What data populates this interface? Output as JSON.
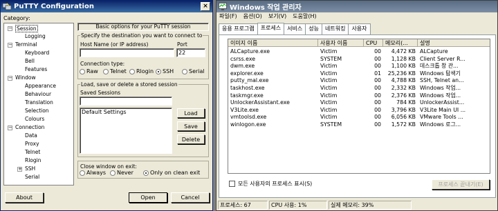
{
  "putty": {
    "title": "PuTTY Configuration",
    "close_btn": "×",
    "category_label": "Category:",
    "tree": [
      {
        "label": "Session",
        "level": 0,
        "toggle": "−",
        "selected": true
      },
      {
        "label": "Logging",
        "level": 1
      },
      {
        "label": "Terminal",
        "level": 0,
        "toggle": "−"
      },
      {
        "label": "Keyboard",
        "level": 1
      },
      {
        "label": "Bell",
        "level": 1
      },
      {
        "label": "Features",
        "level": 1
      },
      {
        "label": "Window",
        "level": 0,
        "toggle": "−"
      },
      {
        "label": "Appearance",
        "level": 1
      },
      {
        "label": "Behaviour",
        "level": 1
      },
      {
        "label": "Translation",
        "level": 1
      },
      {
        "label": "Selection",
        "level": 1
      },
      {
        "label": "Colours",
        "level": 1
      },
      {
        "label": "Connection",
        "level": 0,
        "toggle": "−"
      },
      {
        "label": "Data",
        "level": 1
      },
      {
        "label": "Proxy",
        "level": 1
      },
      {
        "label": "Telnet",
        "level": 1
      },
      {
        "label": "Rlogin",
        "level": 1
      },
      {
        "label": "SSH",
        "level": 1,
        "toggle": "+"
      },
      {
        "label": "Serial",
        "level": 1
      }
    ],
    "header": "Basic options for your PuTTY session",
    "dest_label": "Specify the destination you want to connect to",
    "host_label": "Host Name (or IP address)",
    "host_value": "",
    "port_label": "Port",
    "port_value": "22",
    "conn_type_label": "Connection type:",
    "conn_types": [
      "Raw",
      "Telnet",
      "Rlogin",
      "SSH",
      "Serial"
    ],
    "conn_selected": "SSH",
    "sessions_group": "Load, save or delete a stored session",
    "saved_sessions_label": "Saved Sessions",
    "saved_sessions_value": "",
    "sessions_list": [
      "Default Settings"
    ],
    "load": "Load",
    "save": "Save",
    "delete": "Delete",
    "close_exit_label": "Close window on exit:",
    "close_opts": [
      "Always",
      "Never",
      "Only on clean exit"
    ],
    "close_selected": "Only on clean exit",
    "about": "About",
    "open": "Open",
    "cancel": "Cancel"
  },
  "taskmgr": {
    "title": "Windows 작업 관리자",
    "menu": [
      "파일(F)",
      "옵션(O)",
      "보기(V)",
      "도움말(H)"
    ],
    "tabs": [
      "응용 프로그램",
      "프로세스",
      "서비스",
      "성능",
      "네트워킹",
      "사용자"
    ],
    "active_tab": "프로세스",
    "columns": [
      "이미지 이름",
      "사용자 이름",
      "CPU",
      "메모리(...",
      "설명"
    ],
    "rows": [
      [
        "ALCapture.exe",
        "Victim",
        "00",
        "4,472 KB",
        "ALCapture"
      ],
      [
        "csrss.exe",
        "SYSTEM",
        "00",
        "1,128 KB",
        "Client Server R..."
      ],
      [
        "dwm.exe",
        "Victim",
        "00",
        "1,100 KB",
        "데스크톱 창 관..."
      ],
      [
        "explorer.exe",
        "Victim",
        "01",
        "25,236 KB",
        "Windows 탐색기"
      ],
      [
        "putty_mal.exe",
        "Victim",
        "00",
        "4,788 KB",
        "SSH, Telnet an..."
      ],
      [
        "taskhost.exe",
        "Victim",
        "00",
        "2,332 KB",
        "Windows 작업..."
      ],
      [
        "taskmgr.exe",
        "Victim",
        "00",
        "2,376 KB",
        "Windows 작업..."
      ],
      [
        "UnlockerAssistant.exe",
        "Victim",
        "00",
        "784 KB",
        "UnlockerAssist..."
      ],
      [
        "V3Lite.exe",
        "Victim",
        "00",
        "3,796 KB",
        "V3Lite Main UI ..."
      ],
      [
        "vmtoolsd.exe",
        "Victim",
        "00",
        "6,056 KB",
        "VMware Tools ..."
      ],
      [
        "winlogon.exe",
        "SYSTEM",
        "00",
        "1,572 KB",
        "Windows 로그..."
      ]
    ],
    "show_all": "모든 사용자의 프로세스 표시(S)",
    "end_process": "프로세스 끝내기(E)",
    "status": [
      "프로세스: 67",
      "CPU 사용: 1%",
      "실제 메모리: 39%"
    ]
  }
}
